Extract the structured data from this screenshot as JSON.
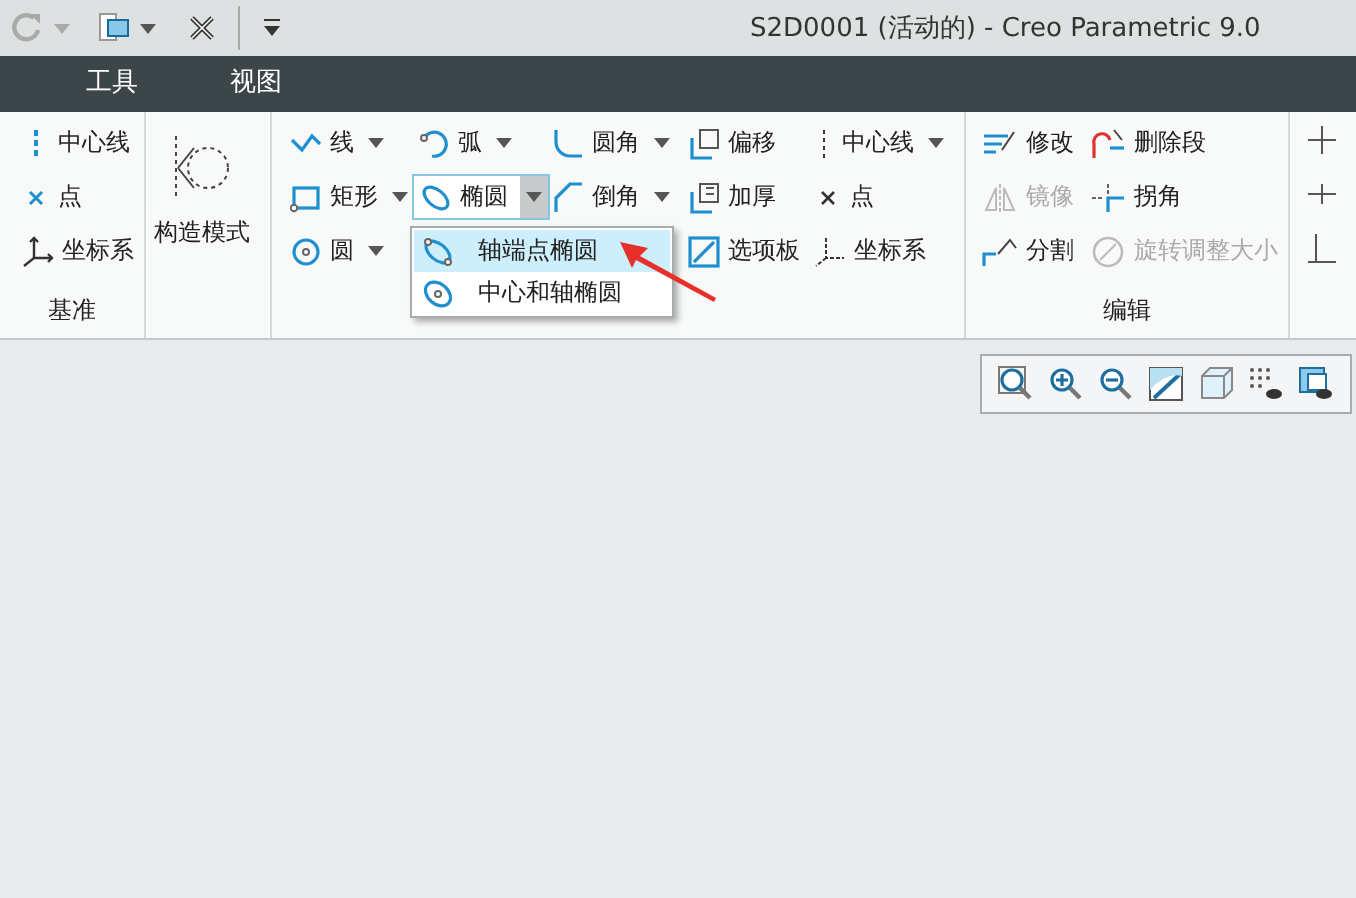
{
  "window": {
    "title": "S2D0001 (活动的) - Creo Parametric 9.0"
  },
  "menu_tabs": [
    {
      "label": "工具",
      "selected": false
    },
    {
      "label": "视图",
      "selected": false
    }
  ],
  "ribbon": {
    "groups": [
      {
        "label": "基准",
        "columns": [
          [
            {
              "label": "中心线",
              "dropdown": false,
              "disabled": false,
              "expanded": false
            },
            {
              "label": "点",
              "dropdown": false,
              "disabled": false,
              "expanded": false
            },
            {
              "label": "坐标系",
              "dropdown": false,
              "disabled": false,
              "expanded": false
            }
          ]
        ]
      },
      {
        "kind": "large",
        "columns": [
          [
            {
              "label": "构造模式",
              "dropdown": false,
              "disabled": false,
              "expanded": false
            }
          ]
        ]
      },
      {
        "columns": [
          [
            {
              "label": "线",
              "dropdown": true,
              "disabled": false,
              "expanded": false
            },
            {
              "label": "矩形",
              "dropdown": true,
              "disabled": false,
              "expanded": false
            },
            {
              "label": "圆",
              "dropdown": true,
              "disabled": false,
              "expanded": false
            }
          ],
          [
            {
              "label": "弧",
              "dropdown": true,
              "disabled": false,
              "expanded": false
            },
            {
              "label": "椭圆",
              "dropdown": true,
              "disabled": false,
              "expanded": true
            }
          ],
          [
            {
              "label": "圆角",
              "dropdown": true,
              "disabled": false,
              "expanded": false
            },
            {
              "label": "倒角",
              "dropdown": true,
              "disabled": false,
              "expanded": false
            }
          ],
          [
            {
              "label": "偏移",
              "dropdown": false,
              "disabled": false,
              "expanded": false
            },
            {
              "label": "加厚",
              "dropdown": false,
              "disabled": false,
              "expanded": false
            },
            {
              "label": "选项板",
              "dropdown": false,
              "disabled": false,
              "expanded": false
            }
          ],
          [
            {
              "label": "中心线",
              "dropdown": true,
              "disabled": false,
              "expanded": false
            },
            {
              "label": "点",
              "dropdown": false,
              "disabled": false,
              "expanded": false
            },
            {
              "label": "坐标系",
              "dropdown": false,
              "disabled": false,
              "expanded": false
            }
          ]
        ]
      },
      {
        "label": "编辑",
        "columns": [
          [
            {
              "label": "修改",
              "dropdown": false,
              "disabled": false,
              "expanded": false
            },
            {
              "label": "镜像",
              "dropdown": false,
              "disabled": true,
              "expanded": false
            },
            {
              "label": "分割",
              "dropdown": false,
              "disabled": false,
              "expanded": false
            }
          ],
          [
            {
              "label": "删除段",
              "dropdown": false,
              "disabled": false,
              "expanded": false
            },
            {
              "label": "拐角",
              "dropdown": false,
              "disabled": false,
              "expanded": false
            },
            {
              "label": "旋转调整大小",
              "dropdown": false,
              "disabled": true,
              "expanded": false
            }
          ]
        ]
      }
    ]
  },
  "dropdown_menu": {
    "items": [
      {
        "label": "轴端点椭圆",
        "selected": true
      },
      {
        "label": "中心和轴椭圆",
        "selected": false
      }
    ]
  }
}
